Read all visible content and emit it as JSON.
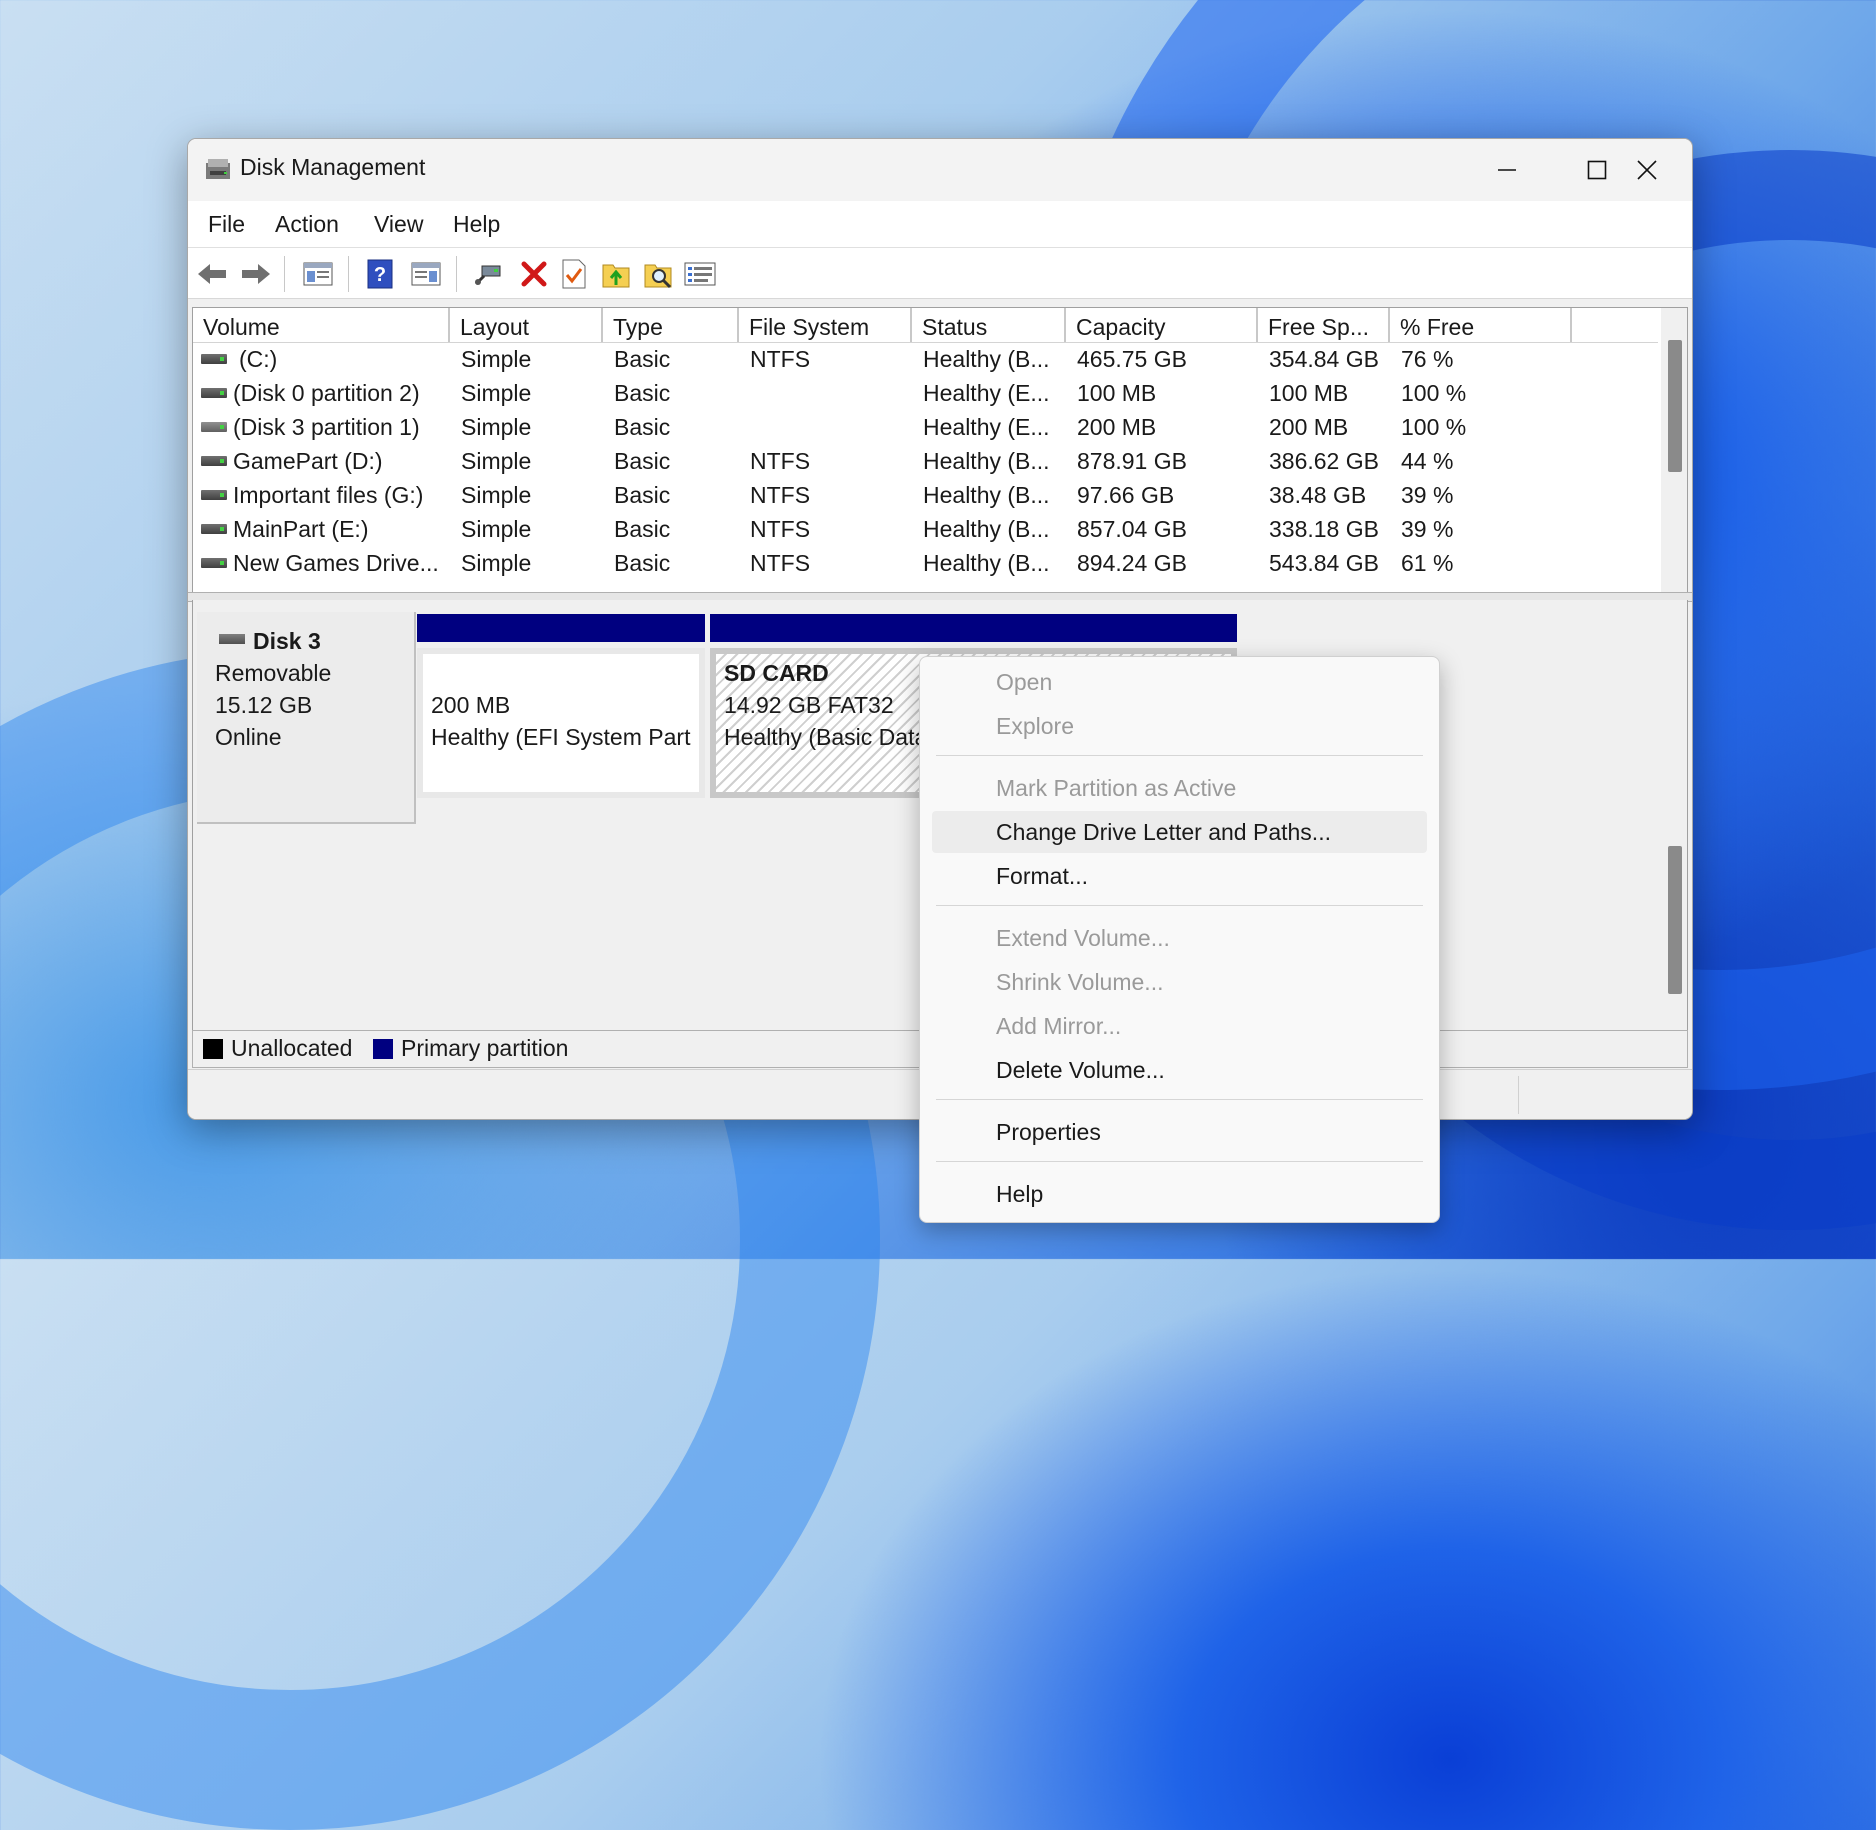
{
  "window": {
    "title": "Disk Management",
    "controls": {
      "minimize": "—",
      "maximize": "☐",
      "close": "✕"
    }
  },
  "menubar": [
    "File",
    "Action",
    "View",
    "Help"
  ],
  "toolbar": [
    "back-arrow-icon",
    "forward-arrow-icon",
    "console-tree-icon",
    "help-icon",
    "action-pane-icon",
    "connect-icon",
    "delete-icon",
    "check-icon",
    "up-folder-icon",
    "search-folder-icon",
    "settings-list-icon"
  ],
  "volume_list": {
    "columns": [
      "Volume",
      "Layout",
      "Type",
      "File System",
      "Status",
      "Capacity",
      "Free Sp...",
      "% Free"
    ],
    "rows": [
      [
        "(C:)",
        "Simple",
        "Basic",
        "NTFS",
        "Healthy (B...",
        "465.75 GB",
        "354.84 GB",
        "76 %"
      ],
      [
        "(Disk 0 partition 2)",
        "Simple",
        "Basic",
        "",
        "Healthy (E...",
        "100 MB",
        "100 MB",
        "100 %"
      ],
      [
        "(Disk 3 partition 1)",
        "Simple",
        "Basic",
        "",
        "Healthy (E...",
        "200 MB",
        "200 MB",
        "100 %"
      ],
      [
        "GamePart (D:)",
        "Simple",
        "Basic",
        "NTFS",
        "Healthy (B...",
        "878.91 GB",
        "386.62 GB",
        "44 %"
      ],
      [
        "Important files (G:)",
        "Simple",
        "Basic",
        "NTFS",
        "Healthy (B...",
        "97.66 GB",
        "38.48 GB",
        "39 %"
      ],
      [
        "MainPart (E:)",
        "Simple",
        "Basic",
        "NTFS",
        "Healthy (B...",
        "857.04 GB",
        "338.18 GB",
        "39 %"
      ],
      [
        "New Games Drive...",
        "Simple",
        "Basic",
        "NTFS",
        "Healthy (B...",
        "894.24 GB",
        "543.84 GB",
        "61 %"
      ]
    ]
  },
  "disk": {
    "name": "Disk 3",
    "type": "Removable",
    "size": "15.12 GB",
    "state": "Online",
    "partitions": [
      {
        "size": "200 MB",
        "status": "Healthy (EFI System Part"
      },
      {
        "label": "SD CARD",
        "size": "14.92 GB FAT32",
        "status": "Healthy (Basic Data"
      }
    ]
  },
  "legend": {
    "unallocated": "Unallocated",
    "primary": "Primary partition",
    "colors": {
      "unallocated": "#000000",
      "primary": "#000080"
    }
  },
  "context_menu": {
    "items": [
      {
        "label": "Open",
        "enabled": false
      },
      {
        "label": "Explore",
        "enabled": false
      },
      {
        "label": "Mark Partition as Active",
        "enabled": false
      },
      {
        "label": "Change Drive Letter and Paths...",
        "enabled": true,
        "highlighted": true
      },
      {
        "label": "Format...",
        "enabled": true
      },
      {
        "label": "Extend Volume...",
        "enabled": false
      },
      {
        "label": "Shrink Volume...",
        "enabled": false
      },
      {
        "label": "Add Mirror...",
        "enabled": false
      },
      {
        "label": "Delete Volume...",
        "enabled": true
      },
      {
        "label": "Properties",
        "enabled": true
      },
      {
        "label": "Help",
        "enabled": true
      }
    ]
  }
}
